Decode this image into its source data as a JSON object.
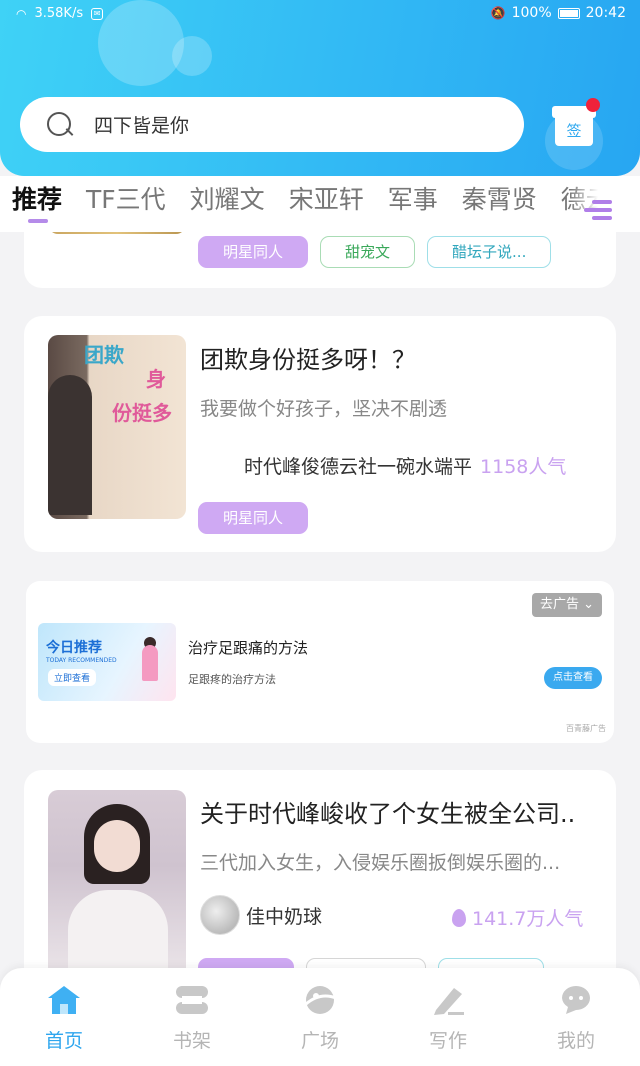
{
  "status_bar": {
    "network_speed": "3.58K/s",
    "battery": "100%",
    "time": "20:42"
  },
  "search": {
    "placeholder": "四下皆是你"
  },
  "checkin": {
    "label": "签"
  },
  "tabs": [
    "推荐",
    "TF三代",
    "刘耀文",
    "宋亚轩",
    "军事",
    "秦霄贤",
    "德云"
  ],
  "feed": {
    "partial_card": {
      "tags": [
        "明星同人",
        "甜宠文",
        "醋坛子说..."
      ]
    },
    "card1": {
      "title": "团欺身份挺多呀！？",
      "description": "我要做个好孩子，坚决不剧透",
      "author": "时代峰俊德云社一碗水端平",
      "popularity": "1158人气",
      "tags": [
        "明星同人"
      ],
      "cover_text_1": "团欺",
      "cover_text_2": "身",
      "cover_text_3": "份挺多"
    },
    "ad": {
      "close_label": "去广告",
      "banner_title": "今日推荐",
      "banner_subtitle": "TODAY RECOMMENDED",
      "banner_button": "立即查看",
      "title": "治疗足跟痛的方法",
      "subtitle": "足跟疼的治疗方法",
      "cta": "点击查看",
      "source": "百青藤广告"
    },
    "card2": {
      "title": "关于时代峰峻收了个女生被全公司..",
      "description": "三代加入女生，入侵娱乐圈扳倒娱乐圈的...",
      "author": "佳中奶球",
      "popularity": "141.7万人气"
    }
  },
  "bottom_nav": [
    {
      "label": "首页",
      "icon": "home-icon",
      "active": true
    },
    {
      "label": "书架",
      "icon": "bookshelf-icon",
      "active": false
    },
    {
      "label": "广场",
      "icon": "planet-icon",
      "active": false
    },
    {
      "label": "写作",
      "icon": "pen-icon",
      "active": false
    },
    {
      "label": "我的",
      "icon": "profile-icon",
      "active": false
    }
  ],
  "colors": {
    "header_start": "#3fd2f6",
    "header_end": "#27a6f2",
    "accent_purple": "#cfa9f3",
    "nav_active": "#2fa6ee"
  }
}
